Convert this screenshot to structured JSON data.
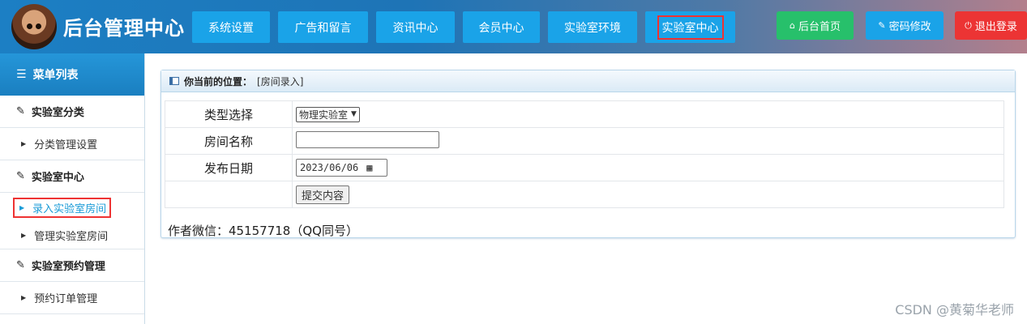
{
  "header": {
    "title": "后台管理中心",
    "nav": [
      "系统设置",
      "广告和留言",
      "资讯中心",
      "会员中心",
      "实验室环境",
      "实验室中心"
    ],
    "actions": {
      "home": "后台首页",
      "password": "密码修改",
      "logout": "退出登录"
    }
  },
  "sidebar": {
    "title": "菜单列表",
    "group1": "实验室分类",
    "item1": "分类管理设置",
    "group2": "实验室中心",
    "item2": "录入实验室房间",
    "item3": "管理实验室房间",
    "group3": "实验室预约管理",
    "item4": "预约订单管理"
  },
  "panel": {
    "location_label": "你当前的位置：",
    "location_value": "[房间录入]",
    "rows": {
      "type_label": "类型选择",
      "type_value": "物理实验室",
      "name_label": "房间名称",
      "name_value": "",
      "date_label": "发布日期",
      "date_value": "2023/06/06",
      "submit": "提交内容"
    },
    "author": "作者微信：45157718（QQ同号）"
  },
  "watermark": "CSDN @黄菊华老师",
  "colors": {
    "header_bg": "#1e74b6",
    "nav_btn": "#1aa3e8",
    "home_btn": "#27c06b",
    "password_btn": "#1aa3e8",
    "logout_btn": "#ec3434",
    "highlight": "#ee3333"
  }
}
